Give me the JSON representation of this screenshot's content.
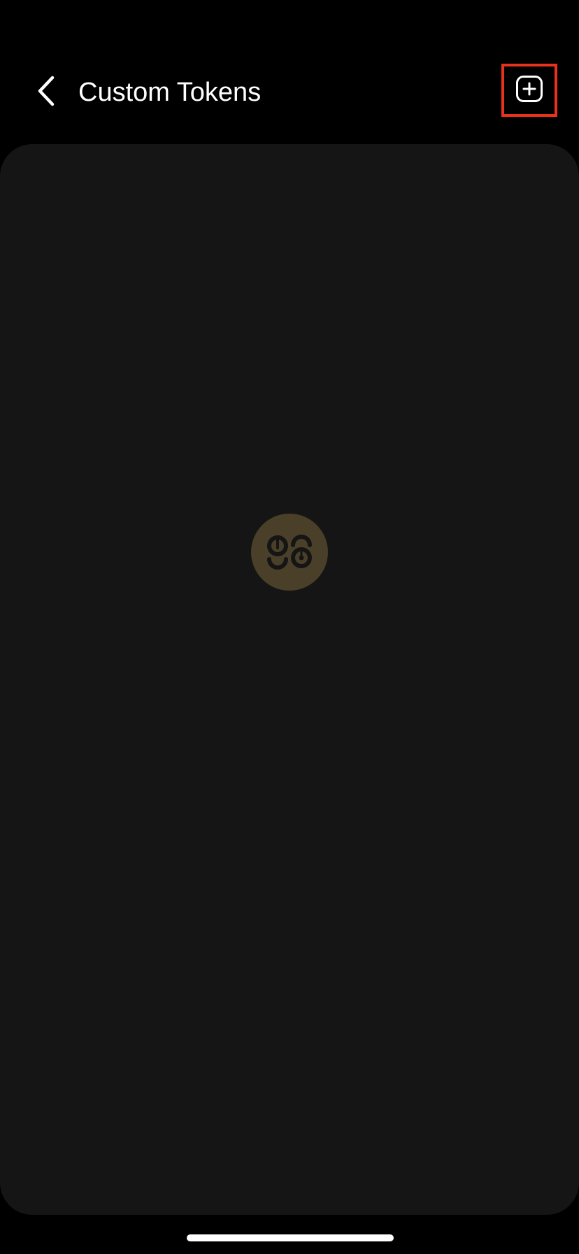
{
  "header": {
    "title": "Custom Tokens",
    "back_icon": "chevron-left-icon",
    "add_icon": "plus-square-icon"
  },
  "content": {
    "state": "loading",
    "loader_icon": "app-logo-icon"
  },
  "colors": {
    "background": "#000000",
    "card": "#151515",
    "highlight_border": "#e8321c",
    "loader_bg": "#4a3f28",
    "loader_mark": "#151515"
  }
}
